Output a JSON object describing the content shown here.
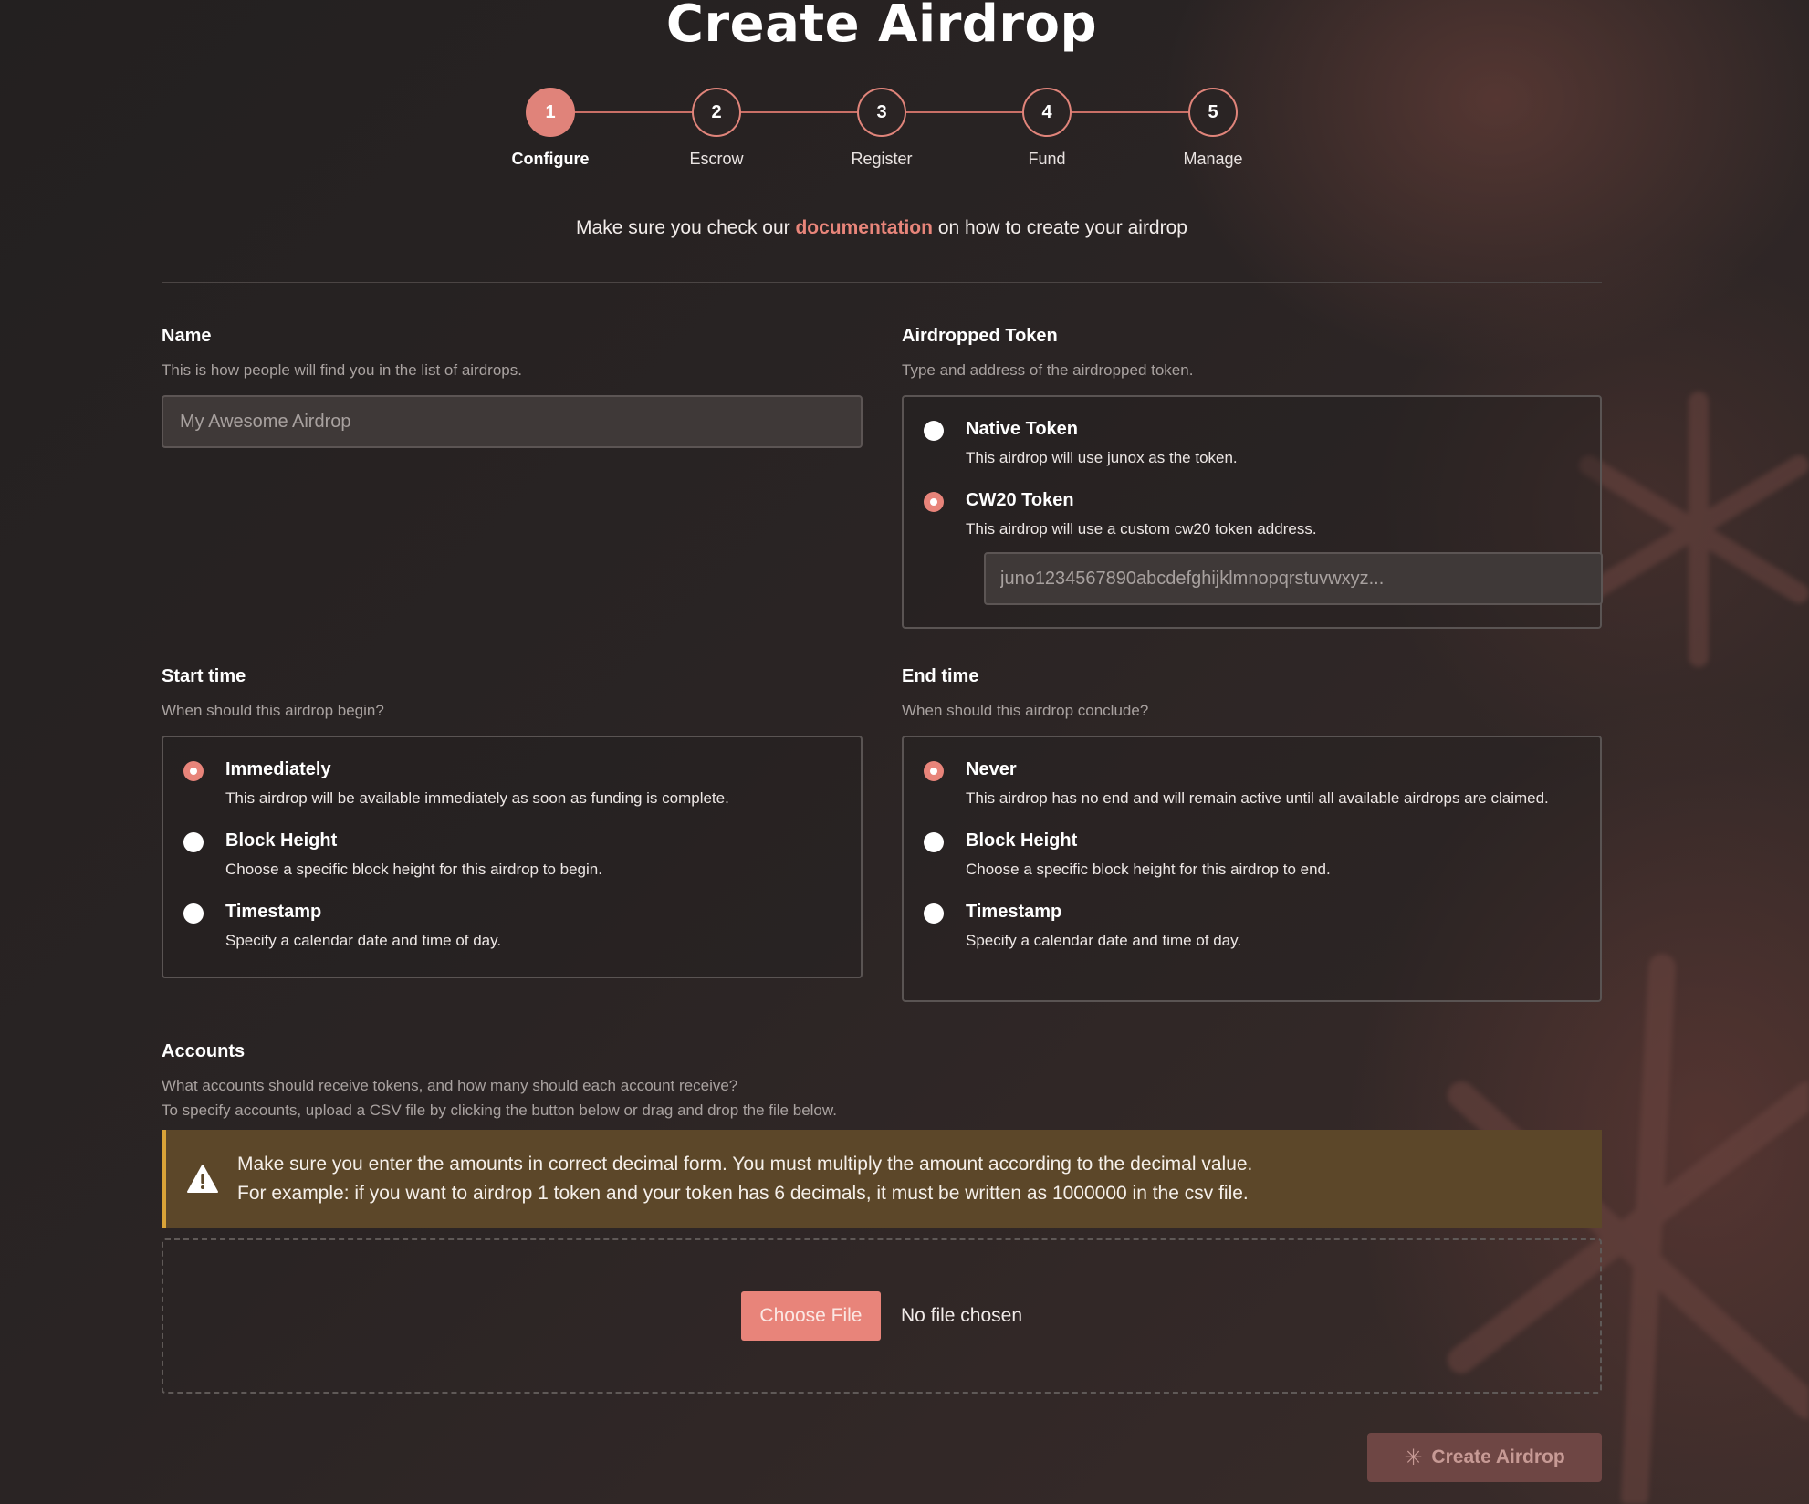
{
  "page": {
    "title": "Create Airdrop"
  },
  "stepper": {
    "steps": [
      {
        "number": "1",
        "label": "Configure",
        "active": true
      },
      {
        "number": "2",
        "label": "Escrow",
        "active": false
      },
      {
        "number": "3",
        "label": "Register",
        "active": false
      },
      {
        "number": "4",
        "label": "Fund",
        "active": false
      },
      {
        "number": "5",
        "label": "Manage",
        "active": false
      }
    ]
  },
  "intro": {
    "prefix": "Make sure you check our",
    "link": "documentation",
    "suffix": "on how to create your airdrop"
  },
  "name": {
    "title": "Name",
    "description": "This is how people will find you in the list of airdrops.",
    "placeholder": "My Awesome Airdrop"
  },
  "token": {
    "title": "Airdropped Token",
    "description": "Type and address of the airdropped token.",
    "options": [
      {
        "title": "Native Token",
        "description": "This airdrop will use junox as the token.",
        "checked": false
      },
      {
        "title": "CW20 Token",
        "description": "This airdrop will use a custom cw20 token address.",
        "checked": true
      }
    ],
    "address_placeholder": "juno1234567890abcdefghijklmnopqrstuvwxyz..."
  },
  "start_time": {
    "title": "Start time",
    "description": "When should this airdrop begin?",
    "options": [
      {
        "title": "Immediately",
        "description": "This airdrop will be available immediately as soon as funding is complete.",
        "checked": true
      },
      {
        "title": "Block Height",
        "description": "Choose a specific block height for this airdrop to begin.",
        "checked": false
      },
      {
        "title": "Timestamp",
        "description": "Specify a calendar date and time of day.",
        "checked": false
      }
    ]
  },
  "end_time": {
    "title": "End time",
    "description": "When should this airdrop conclude?",
    "options": [
      {
        "title": "Never",
        "description": "This airdrop has no end and will remain active until all available airdrops are claimed.",
        "checked": true
      },
      {
        "title": "Block Height",
        "description": "Choose a specific block height for this airdrop to end.",
        "checked": false
      },
      {
        "title": "Timestamp",
        "description": "Specify a calendar date and time of day.",
        "checked": false
      }
    ]
  },
  "accounts": {
    "title": "Accounts",
    "description_line1": "What accounts should receive tokens, and how many should each account receive?",
    "description_line2": "To specify accounts, upload a CSV file by clicking the button below or drag and drop the file below.",
    "warning_line1": "Make sure you enter the amounts in correct decimal form. You must multiply the amount according to the decimal value.",
    "warning_line2": "For example: if you want to airdrop 1 token and your token has 6 decimals, it must be written as 1000000 in the csv file.",
    "choose_file_label": "Choose File",
    "file_status": "No file chosen"
  },
  "actions": {
    "create_label": "Create Airdrop"
  },
  "colors": {
    "accent": "#e8847a",
    "background": "#221f1f",
    "warning_bg": "#5c4729",
    "warning_border": "#d9a338",
    "create_button_bg": "#6e4644"
  },
  "icons": {
    "warning": "warning-triangle-icon",
    "create": "sparkle-icon"
  }
}
